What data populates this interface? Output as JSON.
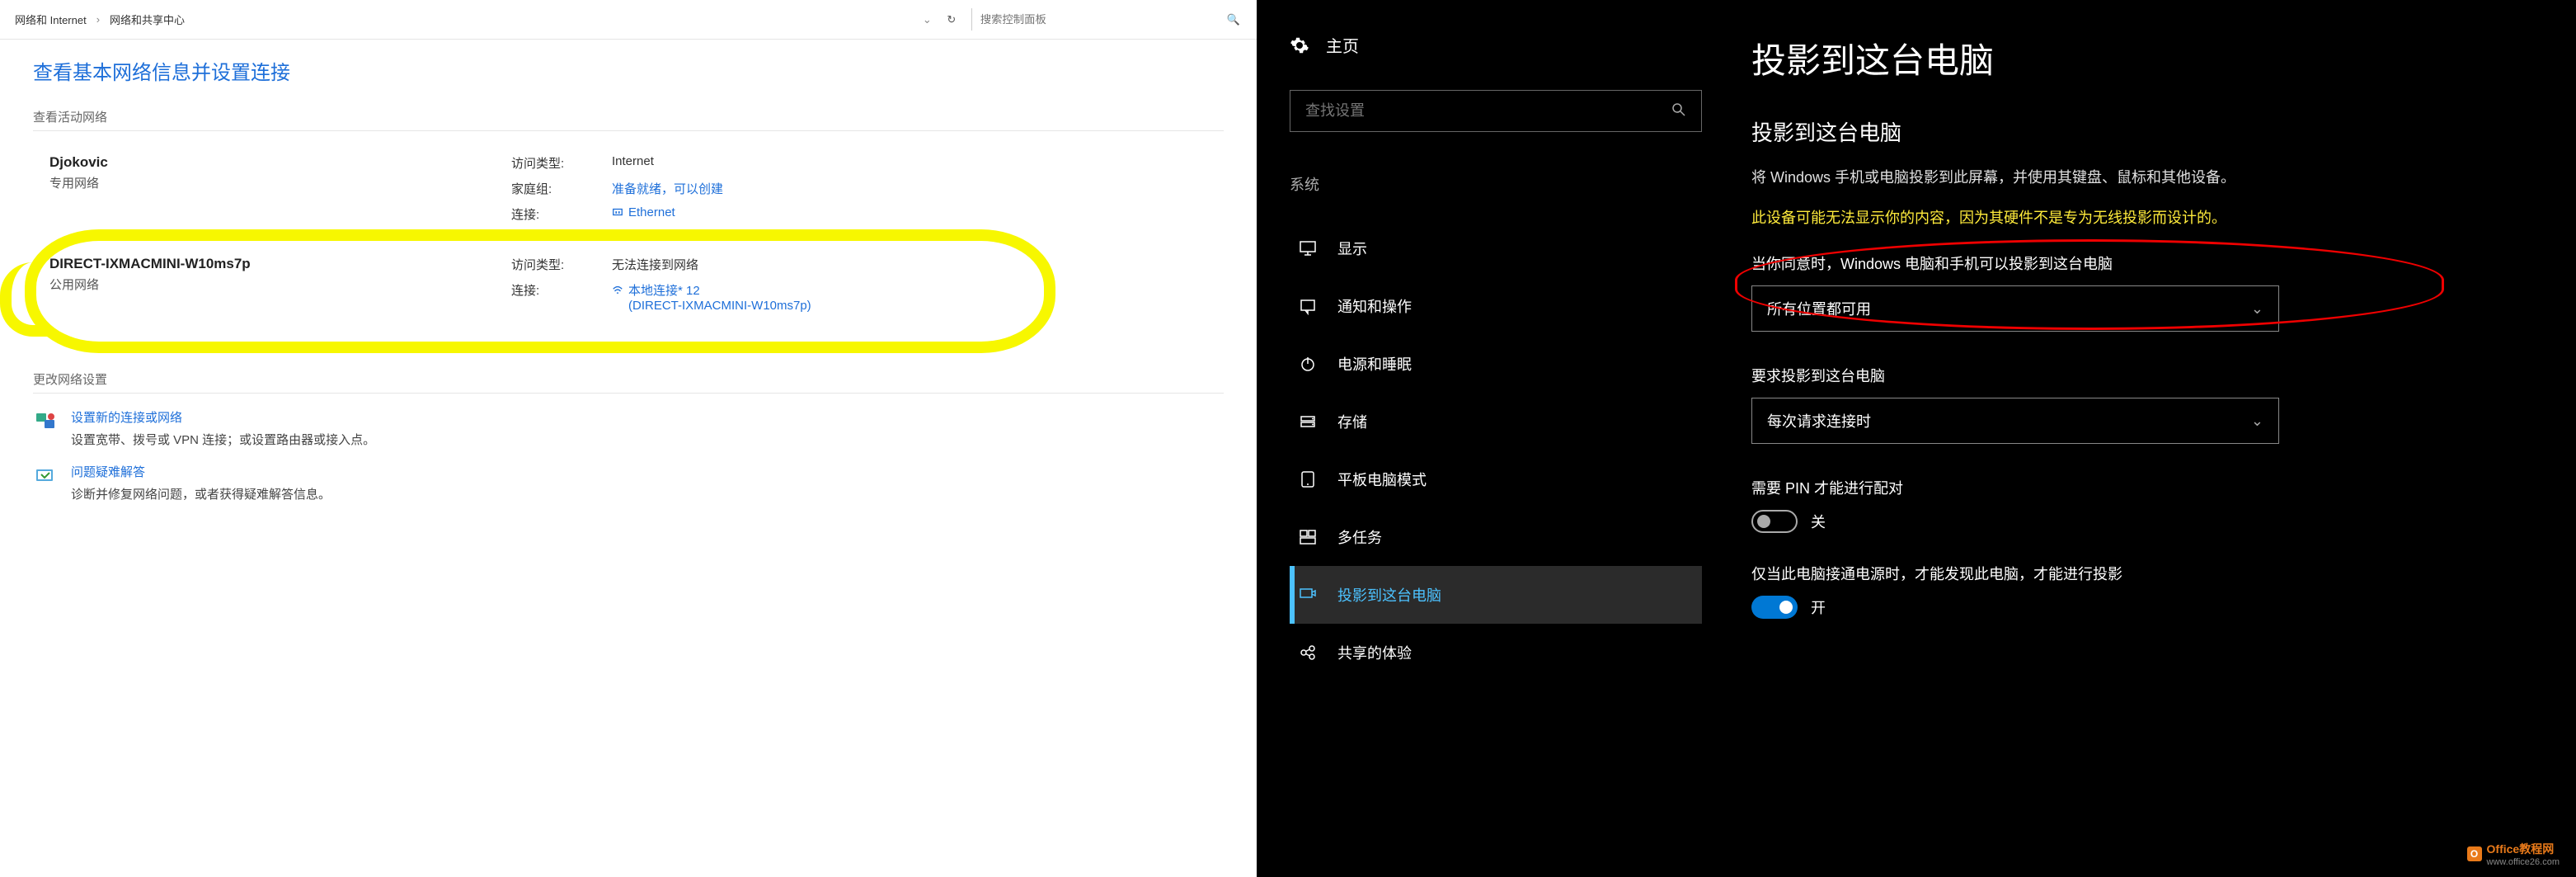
{
  "cp": {
    "breadcrumb": {
      "item1": "网络和 Internet",
      "item2": "网络和共享中心"
    },
    "search_placeholder": "搜索控制面板",
    "heading": "查看基本网络信息并设置连接",
    "active_heading": "查看活动网络",
    "net1": {
      "name": "Djokovic",
      "type": "专用网络",
      "access_lbl": "访问类型:",
      "access_val": "Internet",
      "home_lbl": "家庭组:",
      "home_val": "准备就绪，可以创建",
      "conn_lbl": "连接:",
      "conn_val": "Ethernet"
    },
    "net2": {
      "name": "DIRECT-IXMACMINI-W10ms7p",
      "type": "公用网络",
      "access_lbl": "访问类型:",
      "access_val": "无法连接到网络",
      "conn_lbl": "连接:",
      "conn_val": "本地连接* 12",
      "conn_val2": "(DIRECT-IXMACMINI-W10ms7p)"
    },
    "change_heading": "更改网络设置",
    "task1_title": "设置新的连接或网络",
    "task1_desc": "设置宽带、拨号或 VPN 连接；或设置路由器或接入点。",
    "task2_title": "问题疑难解答",
    "task2_desc": "诊断并修复网络问题，或者获得疑难解答信息。"
  },
  "settings": {
    "home": "主页",
    "search_placeholder": "查找设置",
    "category": "系统",
    "items": {
      "display": "显示",
      "notifications": "通知和操作",
      "power": "电源和睡眠",
      "storage": "存储",
      "tablet": "平板电脑模式",
      "multitask": "多任务",
      "project": "投影到这台电脑",
      "shared": "共享的体验"
    },
    "page_title": "投影到这台电脑",
    "page_subtitle": "投影到这台电脑",
    "desc": "将 Windows 手机或电脑投影到此屏幕，并使用其键盘、鼠标和其他设备。",
    "warning": "此设备可能无法显示你的内容，因为其硬件不是专为无线投影而设计的。",
    "q1_label": "当你同意时，Windows 电脑和手机可以投影到这台电脑",
    "q1_value": "所有位置都可用",
    "q2_label": "要求投影到这台电脑",
    "q2_value": "每次请求连接时",
    "pin_label": "需要 PIN 才能进行配对",
    "pin_state": "关",
    "power_label": "仅当此电脑接通电源时，才能发现此电脑，才能进行投影",
    "power_state": "开"
  },
  "watermark": {
    "brand": "Office教程网",
    "url": "www.office26.com"
  }
}
